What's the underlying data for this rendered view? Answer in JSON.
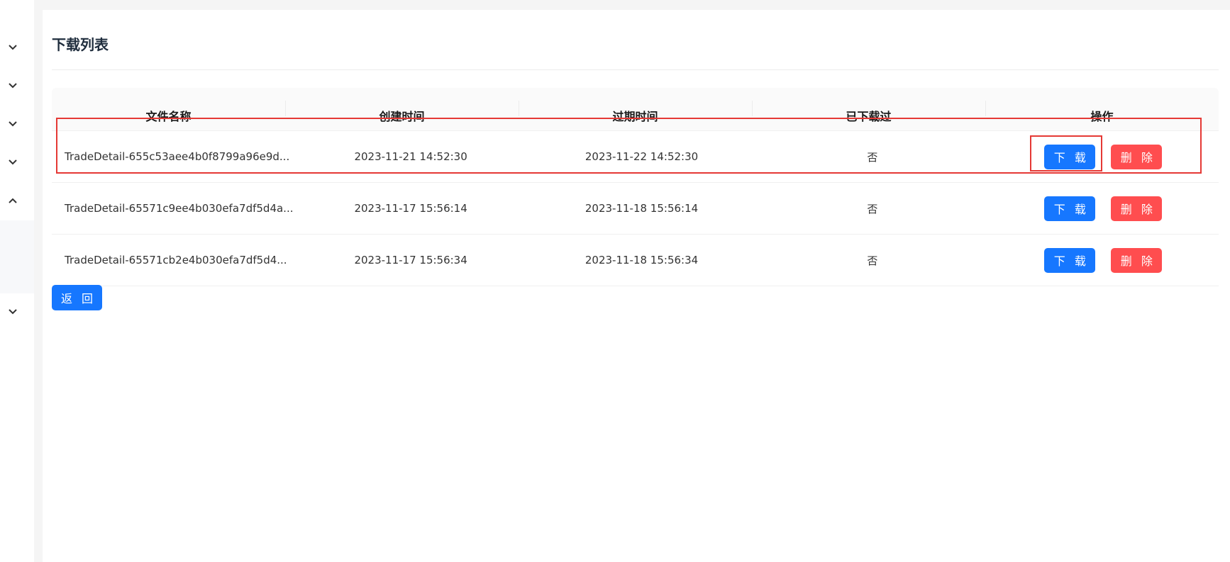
{
  "page": {
    "title": "下载列表",
    "back_label": "返 回"
  },
  "sidebar": {
    "chevrons": [
      "chevron-down",
      "chevron-down",
      "chevron-down",
      "chevron-down",
      "chevron-up",
      "chevron-down"
    ]
  },
  "table": {
    "columns": [
      "文件名称",
      "创建时间",
      "过期时间",
      "已下载过",
      "操作"
    ],
    "rows": [
      {
        "name": "TradeDetail-655c53aee4b0f8799a96e9d...",
        "created": "2023-11-21 14:52:30",
        "expires": "2023-11-22 14:52:30",
        "downloaded": "否",
        "download_label": "下 载",
        "delete_label": "删 除"
      },
      {
        "name": "TradeDetail-65571c9ee4b030efa7df5d4a...",
        "created": "2023-11-17 15:56:14",
        "expires": "2023-11-18 15:56:14",
        "downloaded": "否",
        "download_label": "下 载",
        "delete_label": "删 除"
      },
      {
        "name": "TradeDetail-65571cb2e4b030efa7df5d4...",
        "created": "2023-11-17 15:56:34",
        "expires": "2023-11-18 15:56:34",
        "downloaded": "否",
        "download_label": "下 载",
        "delete_label": "删 除"
      }
    ]
  },
  "colors": {
    "primary": "#1677ff",
    "danger": "#ff4d4f",
    "highlight": "#e53935"
  }
}
